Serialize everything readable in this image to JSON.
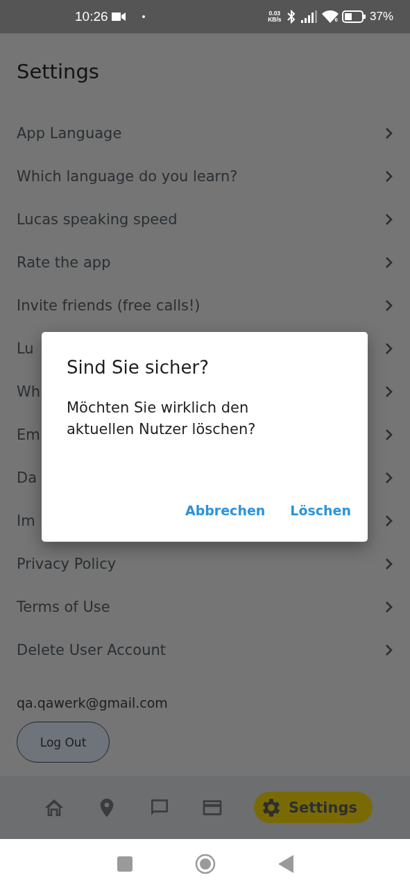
{
  "status_bar": {
    "time": "10:26",
    "speed_value": "0.03",
    "speed_unit": "KB/s",
    "wifi_badge": "6",
    "battery": "37%"
  },
  "title": "Settings",
  "items": [
    {
      "label": "App Language"
    },
    {
      "label": "Which language do you learn?"
    },
    {
      "label": "Lucas speaking speed"
    },
    {
      "label": "Rate the app"
    },
    {
      "label": "Invite friends (free calls!)"
    },
    {
      "label": "Lu"
    },
    {
      "label": "Wh"
    },
    {
      "label": "Em"
    },
    {
      "label": "Da"
    },
    {
      "label": "Im"
    },
    {
      "label": "Privacy Policy"
    },
    {
      "label": "Terms of Use"
    },
    {
      "label": "Delete User Account"
    }
  ],
  "email": "qa.qawerk@gmail.com",
  "logout_button": "Log Out",
  "nav": [
    {
      "kind": "home",
      "selected": false
    },
    {
      "kind": "map",
      "selected": false
    },
    {
      "kind": "chat",
      "selected": false
    },
    {
      "kind": "card",
      "selected": false
    },
    {
      "kind": "settings",
      "label": "Settings",
      "selected": true
    }
  ],
  "dialog": {
    "title": "Sind Sie sicher?",
    "message": "Möchten Sie wirklich den aktuellen Nutzer löschen?",
    "buttons": [
      "Abbrechen",
      "Löschen"
    ]
  }
}
